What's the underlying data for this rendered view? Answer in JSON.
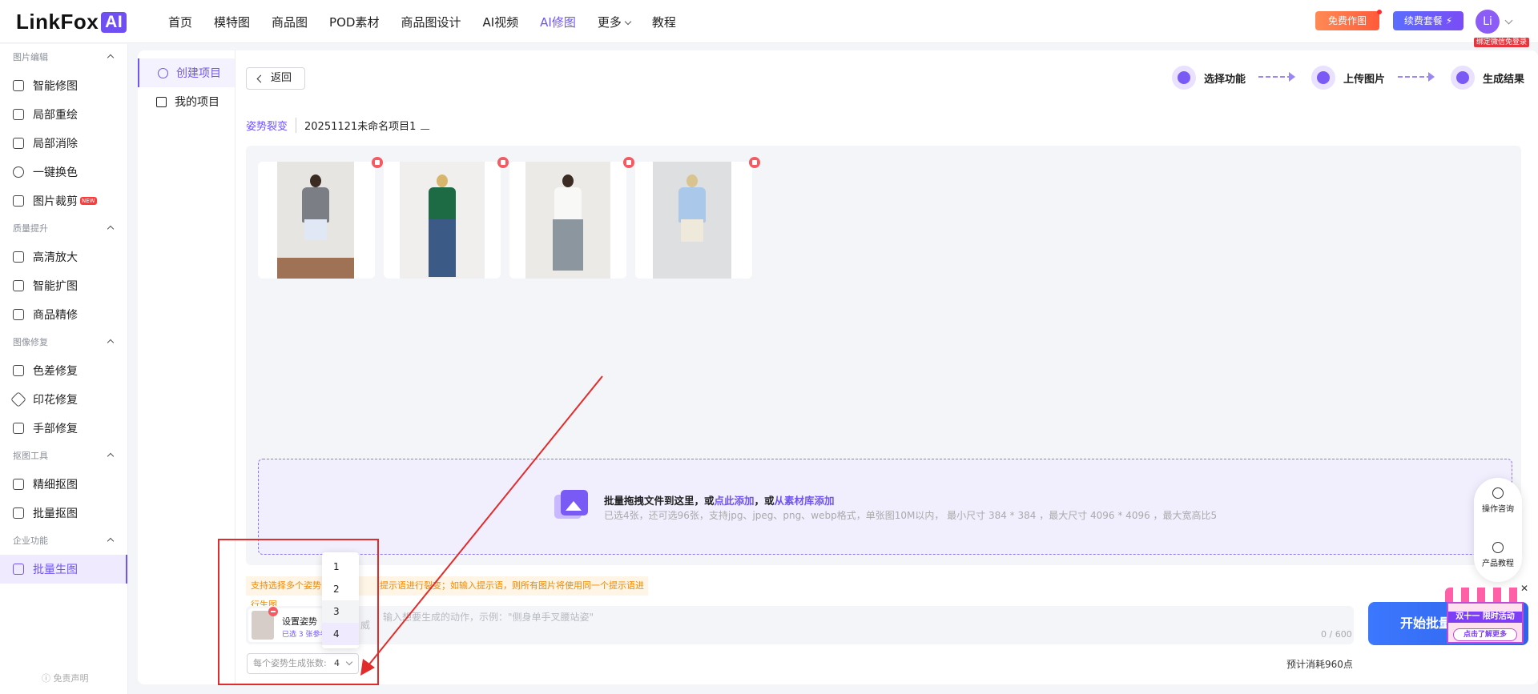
{
  "header": {
    "logo_text": "LinkFox",
    "logo_badge": "AI",
    "nav": [
      "首页",
      "模特图",
      "商品图",
      "POD素材",
      "商品图设计",
      "AI视频",
      "AI修图",
      "更多",
      "教程"
    ],
    "active_nav": "AI修图",
    "free_btn": "免费作图",
    "renew_btn": "续费套餐 ⚡",
    "avatar": "Li",
    "bind_badge": "绑定微信免登录",
    "accent": "#7055f3"
  },
  "sidebar": {
    "groups": [
      {
        "title": "图片编辑",
        "items": [
          "智能修图",
          "局部重绘",
          "局部消除",
          "一键换色",
          "图片裁剪"
        ]
      },
      {
        "title": "质量提升",
        "items": [
          "高清放大",
          "智能扩图",
          "商品精修"
        ]
      },
      {
        "title": "图像修复",
        "items": [
          "色差修复",
          "印花修复",
          "手部修复"
        ]
      },
      {
        "title": "抠图工具",
        "items": [
          "精细抠图",
          "批量抠图"
        ]
      },
      {
        "title": "企业功能",
        "items": [
          "批量生图"
        ]
      }
    ],
    "new_badge": "NEW",
    "active_item": "批量生图",
    "disclaimer": "ⓘ 免责声明"
  },
  "subnav": {
    "items": [
      "创建项目",
      "我的项目"
    ],
    "active": "创建项目"
  },
  "toolbar": {
    "back_label": "返回",
    "steps": [
      "选择功能",
      "上传图片",
      "生成结果"
    ]
  },
  "project": {
    "tag": "姿势裂变",
    "name": "20251121未命名项目1"
  },
  "images": [
    {
      "name": "girl-grey-cardigan",
      "top": "#7b7f85",
      "bottom": "#dfe8f4"
    },
    {
      "name": "woman-green-top",
      "top": "#1d6b45",
      "bottom": "#3b5a86"
    },
    {
      "name": "man-white-tee",
      "top": "#f2f2f0",
      "bottom": "#8c969e"
    },
    {
      "name": "woman-blue-sweater",
      "top": "#a9c8ea",
      "bottom": "#efe9db"
    }
  ],
  "drop_zone": {
    "main_prefix": "批量拖拽文件到这里，或",
    "link1": "点此添加",
    "mid": "，或",
    "link2": "从素材库添加",
    "sub": "已选4张，还可选96张，支持jpg、jpeg、png、webp格式，单张图10M以内， 最小尺寸 384 * 384 ，最大尺寸 4096 * 4096 ，最大宽高比5"
  },
  "prompt": {
    "warning_a": "支持选择多个姿势，",
    "warning_b": "提示语进行裂变；如输入提示语，则所有图片将使用同一个提示语进行生图",
    "pose_label": "设置姿势",
    "pose_sub": "已选 3 张参考",
    "placeholder_pre": "威",
    "placeholder": "输入想要生成的动作，示例：\"侧身单手叉腰站姿\"",
    "counter": "0 / 600"
  },
  "count_select": {
    "label": "每个姿势生成张数:",
    "value": "4",
    "options": [
      "1",
      "2",
      "3",
      "4"
    ],
    "hovered": "3",
    "selected": "4"
  },
  "start_button": "开始批量",
  "cost": "预计消耗960点",
  "float_panel": {
    "consult": "操作咨询",
    "tutorial": "产品教程"
  },
  "promo": {
    "line1": "双十一 限时活动",
    "line2": "点击了解更多"
  }
}
